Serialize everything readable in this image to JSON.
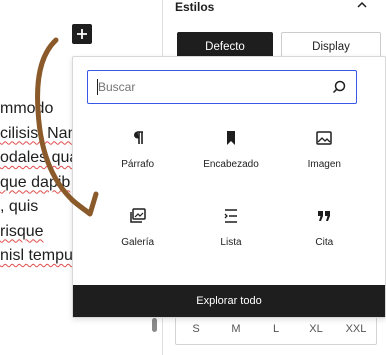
{
  "canvas": {
    "lines": [
      "mmodo",
      "cilisis. Nam",
      "odales qua",
      "que dapib",
      ", quis",
      "risque",
      "nisl tempu"
    ]
  },
  "inserter": {
    "plus_label": "+",
    "search_placeholder": "Buscar",
    "blocks": [
      {
        "label": "Párrafo",
        "icon": "paragraph-icon"
      },
      {
        "label": "Encabezado",
        "icon": "bookmark-icon"
      },
      {
        "label": "Imagen",
        "icon": "image-icon"
      },
      {
        "label": "Galería",
        "icon": "gallery-icon"
      },
      {
        "label": "Lista",
        "icon": "list-icon"
      },
      {
        "label": "Cita",
        "icon": "quote-icon"
      }
    ],
    "explore_label": "Explorar todo"
  },
  "sidebar": {
    "section_title": "Estilos",
    "styles": [
      "Defecto",
      "Display"
    ],
    "font_sizes": [
      "S",
      "M",
      "L",
      "XL",
      "XXL"
    ]
  },
  "colors": {
    "accent": "#3858e9",
    "dark": "#1e1e1e",
    "arrow": "#8b5a2b"
  }
}
